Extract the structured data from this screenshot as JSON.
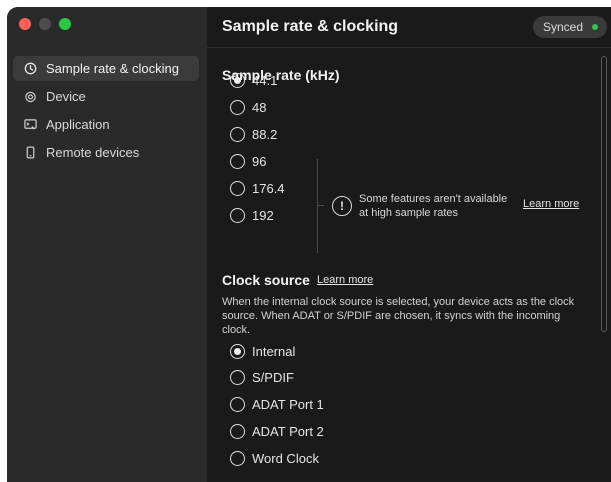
{
  "sidebar": {
    "items": [
      {
        "label": "Sample rate & clocking",
        "icon": "clock-icon",
        "active": true
      },
      {
        "label": "Device",
        "icon": "device-icon",
        "active": false
      },
      {
        "label": "Application",
        "icon": "application-icon",
        "active": false
      },
      {
        "label": "Remote devices",
        "icon": "phone-icon",
        "active": false
      }
    ]
  },
  "header": {
    "title": "Sample rate & clocking",
    "status": "Synced",
    "status_color": "#33c24d"
  },
  "sample_rate": {
    "title": "Sample rate (kHz)",
    "selected": "44.1",
    "options": [
      "44.1",
      "48",
      "88.2",
      "96",
      "176.4",
      "192"
    ],
    "notice_line1": "Some features aren't available",
    "notice_line2": "at high sample rates",
    "learn_more": "Learn more"
  },
  "clock_source": {
    "title": "Clock source",
    "learn_more": "Learn more",
    "description_lines": [
      "When the internal clock source is selected, your device acts as the clock",
      "source. When ADAT or S/PDIF are chosen, it syncs with the incoming",
      "clock."
    ],
    "selected": "Internal",
    "options": [
      "Internal",
      "S/PDIF",
      "ADAT Port 1",
      "ADAT Port 2",
      "Word Clock"
    ]
  }
}
